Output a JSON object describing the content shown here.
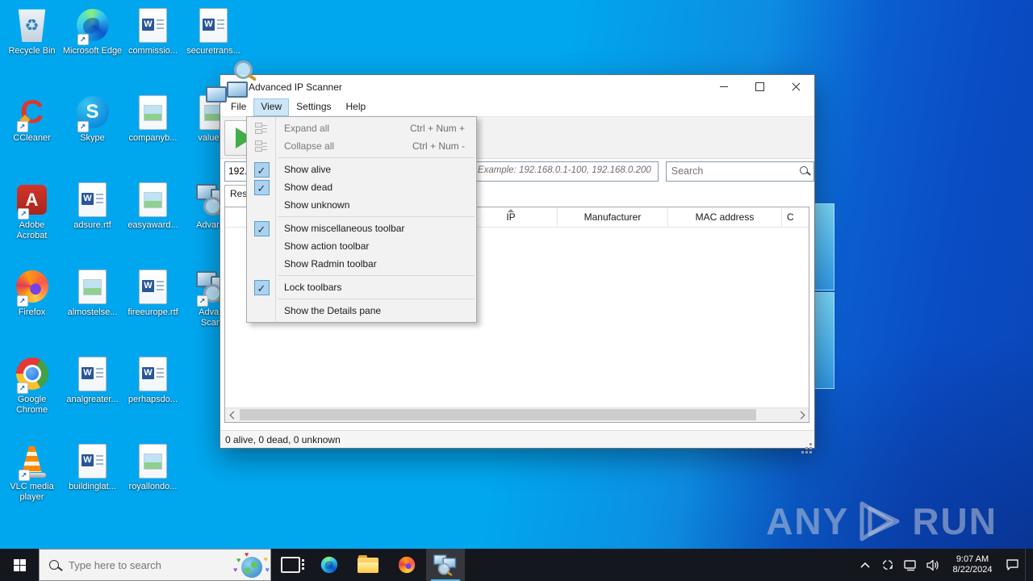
{
  "icons": {
    "word_glyph": "W",
    "skype_glyph": "S",
    "ccleaner_glyph": "C",
    "acrobat_glyph": "A",
    "recycle_glyph": "♻",
    "check_glyph": "✓",
    "shortcut_glyph": "↗",
    "heart_glyph": "♥"
  },
  "desktop": {
    "icons": [
      {
        "label": "Recycle Bin",
        "kind": "recycle"
      },
      {
        "label": "Microsoft Edge",
        "kind": "edge",
        "shortcut": true
      },
      {
        "label": "commissio...",
        "kind": "word"
      },
      {
        "label": "securetrans...",
        "kind": "word"
      },
      {
        "label": "CCleaner",
        "kind": "ccleaner",
        "shortcut": true
      },
      {
        "label": "Skype",
        "kind": "skype",
        "shortcut": true
      },
      {
        "label": "companyb...",
        "kind": "image"
      },
      {
        "label": "valuepe",
        "kind": "image"
      },
      {
        "label": "Adobe\nAcrobat",
        "kind": "acrobat",
        "shortcut": true
      },
      {
        "label": "adsure.rtf",
        "kind": "word"
      },
      {
        "label": "easyaward...",
        "kind": "image"
      },
      {
        "label": "Advance",
        "kind": "ais"
      },
      {
        "label": "Firefox",
        "kind": "firefox",
        "shortcut": true
      },
      {
        "label": "almostelse...",
        "kind": "image"
      },
      {
        "label": "fireeurope.rtf",
        "kind": "word"
      },
      {
        "label": "Advanc\nScann",
        "kind": "ais",
        "shortcut": true
      },
      {
        "label": "Google\nChrome",
        "kind": "chrome",
        "shortcut": true
      },
      {
        "label": "analgreater...",
        "kind": "word"
      },
      {
        "label": "perhapsdo...",
        "kind": "word"
      },
      {
        "label": "",
        "kind": "empty"
      },
      {
        "label": "VLC media\nplayer",
        "kind": "vlc",
        "shortcut": true
      },
      {
        "label": "buildinglat...",
        "kind": "word"
      },
      {
        "label": "royallondo...",
        "kind": "image"
      },
      {
        "label": "",
        "kind": "empty"
      }
    ]
  },
  "window": {
    "title": "Advanced IP Scanner",
    "menus": [
      "File",
      "View",
      "Settings",
      "Help"
    ],
    "active_menu": "View",
    "view_menu": [
      {
        "label": "Expand all",
        "shortcut": "Ctrl + Num +",
        "disabled": true,
        "icon": "expand-all"
      },
      {
        "label": "Collapse all",
        "shortcut": "Ctrl + Num -",
        "disabled": true,
        "icon": "collapse-all",
        "sep": true
      },
      {
        "label": "Show alive",
        "checked": true
      },
      {
        "label": "Show dead",
        "checked": true
      },
      {
        "label": "Show unknown",
        "sep": true
      },
      {
        "label": "Show miscellaneous toolbar",
        "checked": true
      },
      {
        "label": "Show action toolbar"
      },
      {
        "label": "Show Radmin toolbar",
        "sep": true
      },
      {
        "label": "Lock toolbars",
        "checked": true,
        "sep": true
      },
      {
        "label": "Show the Details pane"
      }
    ],
    "ip_field": {
      "value": "192.1",
      "hint": "Example: 192.168.0.1-100, 192.168.0.200"
    },
    "search": {
      "placeholder": "Search"
    },
    "results_tab": "Resu",
    "table": {
      "columns": [
        "",
        "IP",
        "Manufacturer",
        "MAC address",
        "C"
      ],
      "sorted_column": "IP"
    },
    "status": "0 alive, 0 dead, 0 unknown"
  },
  "taskbar": {
    "search_placeholder": "Type here to search",
    "apps": [
      {
        "name": "task-view"
      },
      {
        "name": "microsoft-edge"
      },
      {
        "name": "file-explorer"
      },
      {
        "name": "firefox"
      },
      {
        "name": "advanced-ip-scanner",
        "active": true
      }
    ],
    "clock": {
      "time": "9:07 AM",
      "date": "8/22/2024"
    }
  },
  "watermark": {
    "left": "ANY",
    "right": "RUN"
  }
}
